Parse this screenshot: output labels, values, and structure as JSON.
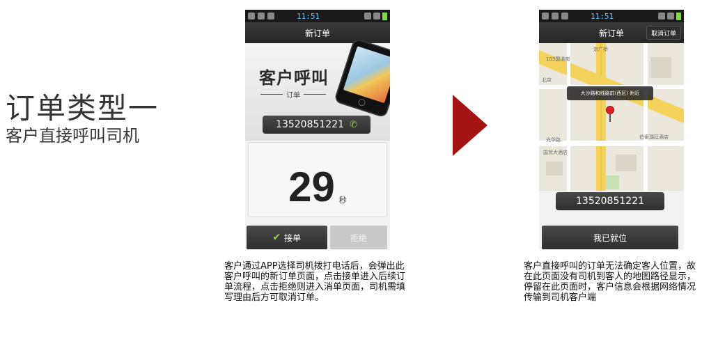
{
  "page": {
    "title": "订单类型一",
    "subtitle": "客户直接呼叫司机"
  },
  "status_bar": {
    "time": "11:51"
  },
  "screen1": {
    "title": "新订单",
    "banner_title": "客户呼叫",
    "banner_sub": "订单",
    "phone_number": "13520851221",
    "timer_value": "29",
    "timer_unit": "秒",
    "accept_label": "接单",
    "reject_label": "拒绝"
  },
  "screen2": {
    "title": "新订单",
    "cancel_label": "取消订单",
    "map_tooltip": "大沙路和线路前(西区) 附近",
    "map_labels": [
      "京广桥",
      "103国道南",
      "北京",
      "光华路",
      "国贸大酒店",
      "伯豪瑞廷酒店"
    ],
    "phone_number": "13520851221",
    "ready_label": "我已就位"
  },
  "descriptions": {
    "left": "客户通过APP选择司机拨打电话后，会弹出此客户呼叫的新订单页面，点击接单进入后续订单流程，点击拒绝则进入消单页面，司机需填写理由后方可取消订单。",
    "right": "客户直接呼叫的订单无法确定客人位置，故在此页面没有司机到客人的地图路径显示，停留在此页面时，客户信息会根据网络情况传输到司机客户端"
  },
  "colors": {
    "arrow": "#a31313",
    "accent_green": "#8fd14f"
  }
}
